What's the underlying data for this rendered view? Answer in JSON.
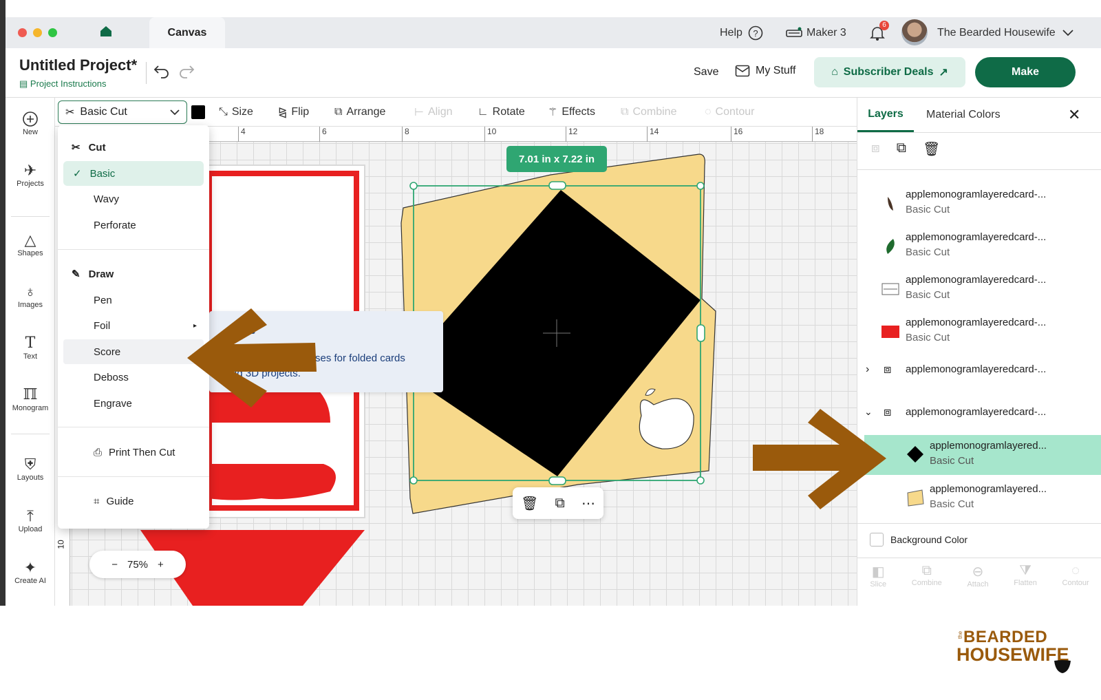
{
  "titlebar": {
    "tab_label": "Canvas",
    "help_label": "Help",
    "machine_label": "Maker 3",
    "notification_count": "6",
    "user_name": "The Bearded Housewife"
  },
  "project": {
    "title": "Untitled Project*",
    "instructions_label": "Project Instructions",
    "save_label": "Save",
    "mystuff_label": "My Stuff",
    "subscriber_label": "Subscriber Deals",
    "make_label": "Make"
  },
  "leftnav": {
    "items": [
      {
        "label": "New",
        "icon": "plus-circle-icon"
      },
      {
        "label": "Projects",
        "icon": "rocket-icon"
      },
      {
        "label": "Shapes",
        "icon": "shapes-icon"
      },
      {
        "label": "Images",
        "icon": "bulb-icon"
      },
      {
        "label": "Text",
        "icon": "text-icon"
      },
      {
        "label": "Monogram",
        "icon": "monogram-icon"
      },
      {
        "label": "Layouts",
        "icon": "shirt-icon"
      },
      {
        "label": "Upload",
        "icon": "upload-icon"
      },
      {
        "label": "Create AI",
        "icon": "sparkle-icon"
      }
    ]
  },
  "toolbar": {
    "operation": "Basic Cut",
    "size": "Size",
    "flip": "Flip",
    "arrange": "Arrange",
    "align": "Align",
    "rotate": "Rotate",
    "effects": "Effects",
    "combine": "Combine",
    "contour": "Contour"
  },
  "ruler": {
    "ticks": [
      "4",
      "6",
      "8",
      "10",
      "12",
      "14",
      "16",
      "18"
    ],
    "left_tick": "10"
  },
  "menu": {
    "cut_header": "Cut",
    "cut_items": [
      "Basic",
      "Wavy",
      "Perforate"
    ],
    "draw_header": "Draw",
    "draw_items": [
      "Pen",
      "Foil",
      "Score",
      "Deboss",
      "Engrave"
    ],
    "print_then_cut": "Print Then Cut",
    "guide": "Guide"
  },
  "tooltip": {
    "title_fragment": "ore",
    "line1": "ses for folded cards",
    "line2": "nd 3D projects."
  },
  "selection": {
    "size_label": "7.01  in x 7.22  in"
  },
  "zoom": {
    "value": "75%",
    "minus": "−",
    "plus": "+"
  },
  "rightpanel": {
    "tab_layers": "Layers",
    "tab_colors": "Material Colors",
    "layers": [
      {
        "name": "applemonogramlayeredcard-...",
        "op": "Basic Cut",
        "color": "#4a3426"
      },
      {
        "name": "applemonogramlayeredcard-...",
        "op": "Basic Cut",
        "color": "#1f6b2e"
      },
      {
        "name": "applemonogramlayeredcard-...",
        "op": "Basic Cut",
        "color": "#ffffff"
      },
      {
        "name": "applemonogramlayeredcard-...",
        "op": "Basic Cut",
        "color": "#e82020"
      },
      {
        "name": "applemonogramlayeredcard-...",
        "op": ""
      },
      {
        "name": "applemonogramlayeredcard-...",
        "op": ""
      },
      {
        "name": "applemonogramlayered...",
        "op": "Basic Cut",
        "color": "#000000"
      },
      {
        "name": "applemonogramlayered...",
        "op": "Basic Cut",
        "color": "#f7d98b"
      }
    ],
    "background_color": "Background Color",
    "bottom_actions": [
      "Slice",
      "Combine",
      "Attach",
      "Flatten",
      "Contour"
    ]
  },
  "logo": {
    "prefix": "the",
    "line1": "BEARDED",
    "line2": "HOUSEWIFE"
  },
  "colors": {
    "accent": "#0f6b47",
    "arrow": "#9a5a0c",
    "selection": "#2fa672",
    "card": "#f7d98b",
    "red": "#e82020"
  }
}
